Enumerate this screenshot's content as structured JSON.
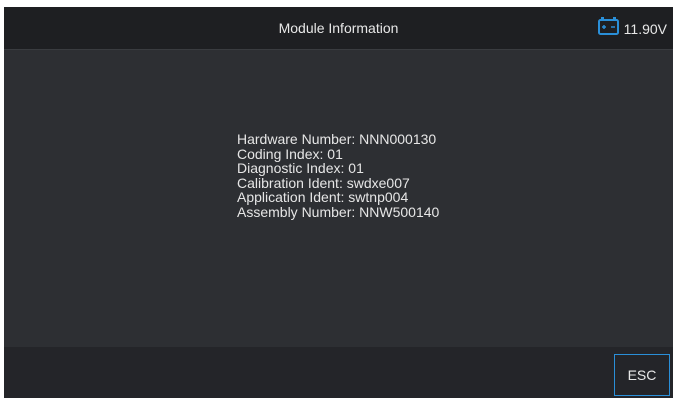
{
  "header": {
    "title": "Module Information",
    "battery": {
      "icon": "battery-icon",
      "voltage": "11.90V",
      "color": "#2a8fd8"
    }
  },
  "module_info": {
    "lines": [
      "Hardware Number: NNN000130",
      "Coding Index: 01",
      "Diagnostic Index: 01",
      "Calibration Ident: swdxe007",
      "Application Ident: swtnp004",
      "Assembly Number: NNW500140"
    ]
  },
  "footer": {
    "esc_label": "ESC"
  }
}
